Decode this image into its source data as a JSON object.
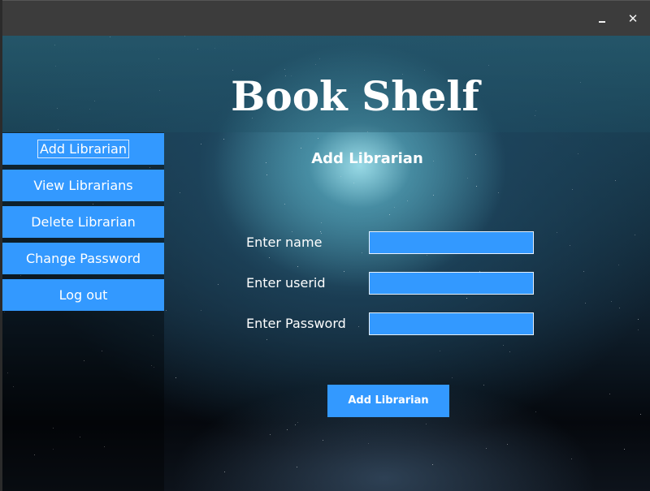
{
  "window": {
    "title": "",
    "minimize_icon": "minimize-icon",
    "close_glyph": "✕"
  },
  "app": {
    "title": "Book Shelf"
  },
  "sidebar": {
    "items": [
      {
        "label": "Add Librarian",
        "focused": true
      },
      {
        "label": "View Librarians"
      },
      {
        "label": "Delete Librarian"
      },
      {
        "label": "Change Password"
      },
      {
        "label": "Log out"
      }
    ]
  },
  "form": {
    "heading": "Add Librarian",
    "name_label": "Enter name",
    "name_value": "",
    "userid_label": "Enter userid",
    "userid_value": "",
    "password_label": "Enter Password",
    "password_value": "",
    "submit_label": "Add Librarian"
  },
  "colors": {
    "accent": "#3399ff",
    "titlebar": "#3c3c3c"
  }
}
